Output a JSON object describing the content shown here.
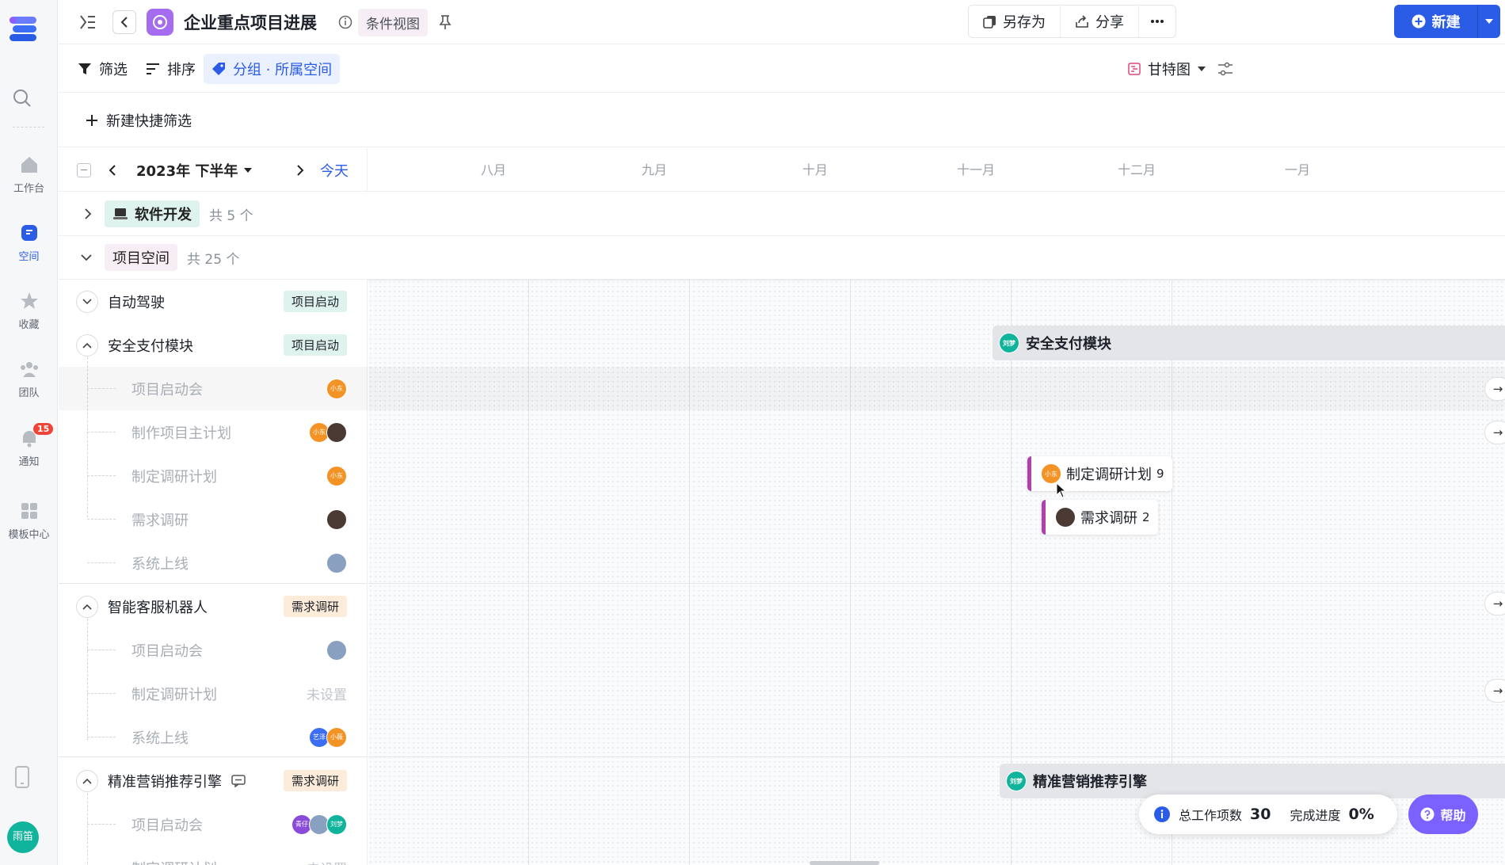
{
  "rail": {
    "items": [
      {
        "label": "工作台",
        "icon": "home-icon"
      },
      {
        "label": "空间",
        "icon": "space-icon",
        "active": true
      },
      {
        "label": "收藏",
        "icon": "star-icon"
      },
      {
        "label": "团队",
        "icon": "team-icon"
      },
      {
        "label": "通知",
        "icon": "bell-icon",
        "badge": "15"
      },
      {
        "label": "模板中心",
        "icon": "template-icon"
      }
    ],
    "user_avatar": "雨笛"
  },
  "header": {
    "title": "企业重点项目进展",
    "view_tag": "条件视图",
    "save_as": "另存为",
    "share": "分享",
    "new": "新建"
  },
  "toolbar": {
    "filter": "筛选",
    "sort": "排序",
    "group": "分组 · 所属空间",
    "view_mode": "甘特图"
  },
  "quick_filter": "新建快捷筛选",
  "timeline": {
    "period": "2023年 下半年",
    "today": "今天",
    "months": [
      "八月",
      "九月",
      "十月",
      "十一月",
      "十二月",
      "一月"
    ]
  },
  "groups": [
    {
      "name": "软件开发",
      "count": "共 5 个",
      "expanded": false
    },
    {
      "name": "项目空间",
      "count": "共 25 个",
      "expanded": true
    }
  ],
  "projects": [
    {
      "name": "自动驾驶",
      "status": "项目启动",
      "status_color": "green",
      "expanded": false
    },
    {
      "name": "安全支付模块",
      "status": "项目启动",
      "status_color": "green",
      "expanded": true,
      "bar_label": "安全支付模块",
      "bar_avatar": "刘梦",
      "children": [
        {
          "name": "项目启动会",
          "assignees": [
            "小东"
          ]
        },
        {
          "name": "制作项目主计划",
          "assignees": [
            "小东",
            "photo"
          ]
        },
        {
          "name": "制定调研计划",
          "assignees": [
            "小东"
          ]
        },
        {
          "name": "需求调研",
          "assignees": [
            "photo"
          ]
        },
        {
          "name": "系统上线",
          "assignees": [
            "photo2"
          ]
        }
      ]
    },
    {
      "name": "智能客服机器人",
      "status": "需求调研",
      "status_color": "orange",
      "expanded": true,
      "children": [
        {
          "name": "项目启动会",
          "assignees": [
            "photo2"
          ]
        },
        {
          "name": "制定调研计划",
          "assignees": [],
          "unset": "未设置"
        },
        {
          "name": "系统上线",
          "assignees": [
            "艺泽",
            "小薇"
          ]
        }
      ]
    },
    {
      "name": "精准营销推荐引擎",
      "status": "需求调研",
      "status_color": "orange",
      "expanded": true,
      "bar_label": "精准营销推荐引擎",
      "bar_avatar": "刘梦",
      "children": [
        {
          "name": "项目启动会",
          "assignees": [
            "青仔",
            "photo2",
            "刘梦"
          ]
        },
        {
          "name": "制定调研计划",
          "assignees": [],
          "unset": "未设置"
        }
      ]
    }
  ],
  "task_chips": [
    {
      "label": "制定调研计划",
      "count": "9",
      "avatar": "小东"
    },
    {
      "label": "需求调研",
      "count": "2",
      "avatar": "photo"
    }
  ],
  "summary": {
    "total_label": "总工作项数",
    "total": "30",
    "progress_label": "完成进度",
    "progress": "0%"
  },
  "help": "帮助",
  "colors": {
    "accent": "#2b5ce6",
    "help": "#7b61ff",
    "task_marker": "#b23fae",
    "avatar_orange": "#f39325",
    "avatar_green": "#10b39b",
    "avatar_purple": "#8a4bd8",
    "avatar_blue": "#3b6ef5"
  }
}
